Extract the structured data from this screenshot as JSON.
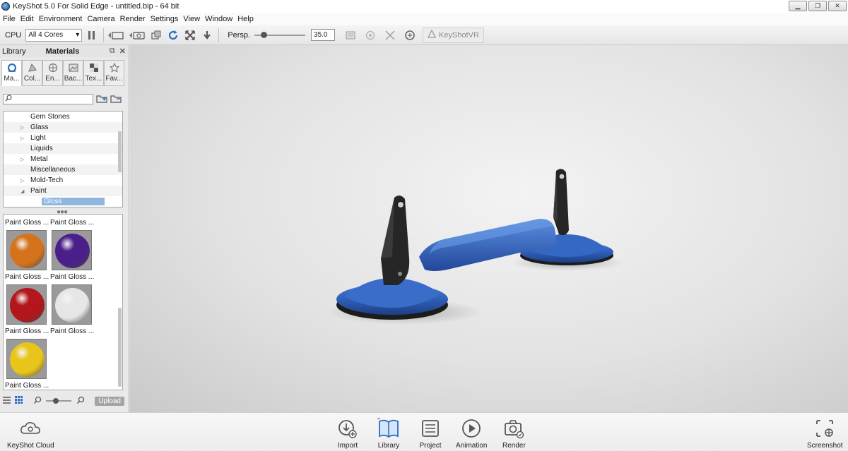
{
  "window": {
    "title": "KeyShot 5.0 For Solid Edge - untitled.bip  - 64 bit"
  },
  "menu": [
    "File",
    "Edit",
    "Environment",
    "Camera",
    "Render",
    "Settings",
    "View",
    "Window",
    "Help"
  ],
  "toolbar": {
    "cpu_label": "CPU",
    "cpu_select_value": "All 4 Cores",
    "perspective_label": "Persp.",
    "perspective_slider_fraction": 0.18,
    "fov_value": "35.0",
    "keyshotvr_label": "KeyShotVR"
  },
  "library": {
    "header_left": "Library",
    "header_title": "Materials",
    "tabs": [
      {
        "label": "Ma...",
        "icon": "materials-icon",
        "active": true
      },
      {
        "label": "Col...",
        "icon": "colors-icon",
        "active": false
      },
      {
        "label": "En...",
        "icon": "environments-icon",
        "active": false
      },
      {
        "label": "Bac...",
        "icon": "backplates-icon",
        "active": false
      },
      {
        "label": "Tex...",
        "icon": "textures-icon",
        "active": false
      },
      {
        "label": "Fav...",
        "icon": "favorites-icon",
        "active": false
      }
    ],
    "tree": [
      {
        "label": "Gem Stones",
        "arrow": ""
      },
      {
        "label": "Glass",
        "arrow": "▷"
      },
      {
        "label": "Light",
        "arrow": "▷"
      },
      {
        "label": "Liquids",
        "arrow": ""
      },
      {
        "label": "Metal",
        "arrow": "▷"
      },
      {
        "label": "Miscellaneous",
        "arrow": ""
      },
      {
        "label": "Mold-Tech",
        "arrow": "▷"
      },
      {
        "label": "Paint",
        "arrow": "◢"
      },
      {
        "label": "Gloss",
        "arrow": "",
        "selected": true
      }
    ],
    "thumbnails": {
      "top_labels": [
        "Paint Gloss ...",
        "Paint Gloss ..."
      ],
      "items": [
        {
          "label": "Paint Gloss ...",
          "color": "#d4731c"
        },
        {
          "label": "Paint Gloss ...",
          "color": "#4b1f8a"
        },
        {
          "label": "Paint Gloss ...",
          "color": "#b3161b"
        },
        {
          "label": "Paint Gloss ...",
          "color": "#e6e6e6"
        },
        {
          "label": "Paint Gloss ...",
          "color": "#e8c51a"
        }
      ]
    },
    "upload_label": "Upload"
  },
  "bottom_bar": {
    "cloud_label": "KeyShot Cloud",
    "items": [
      "Import",
      "Library",
      "Project",
      "Animation",
      "Render"
    ],
    "screenshot_label": "Screenshot"
  },
  "colors": {
    "model_blue": "#2f5fb8",
    "model_black": "#1c1c1c",
    "selection": "#8fb6df"
  }
}
